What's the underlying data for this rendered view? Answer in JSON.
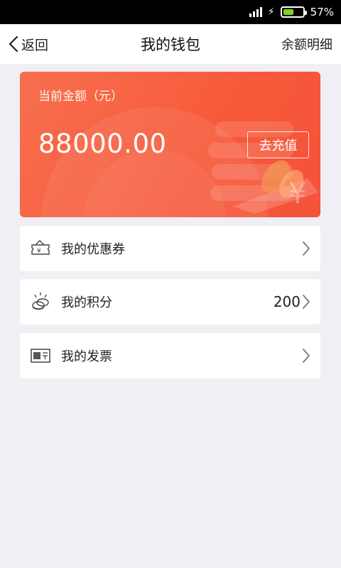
{
  "status_bar": {
    "battery_text": "57%",
    "battery_level": 0.57,
    "battery_color": "#7ed321"
  },
  "nav": {
    "back_label": "返回",
    "title": "我的钱包",
    "right_label": "余额明细"
  },
  "card": {
    "label": "当前金额（元）",
    "amount": "88000.00",
    "recharge_label": "去充值",
    "colors": {
      "start": "#f76f4f",
      "end": "#f5523a"
    }
  },
  "menu": [
    {
      "label": "我的优惠券",
      "icon": "coupon-icon",
      "value": ""
    },
    {
      "label": "我的积分",
      "icon": "coins-icon",
      "value": "200"
    },
    {
      "label": "我的发票",
      "icon": "invoice-icon",
      "value": ""
    }
  ]
}
